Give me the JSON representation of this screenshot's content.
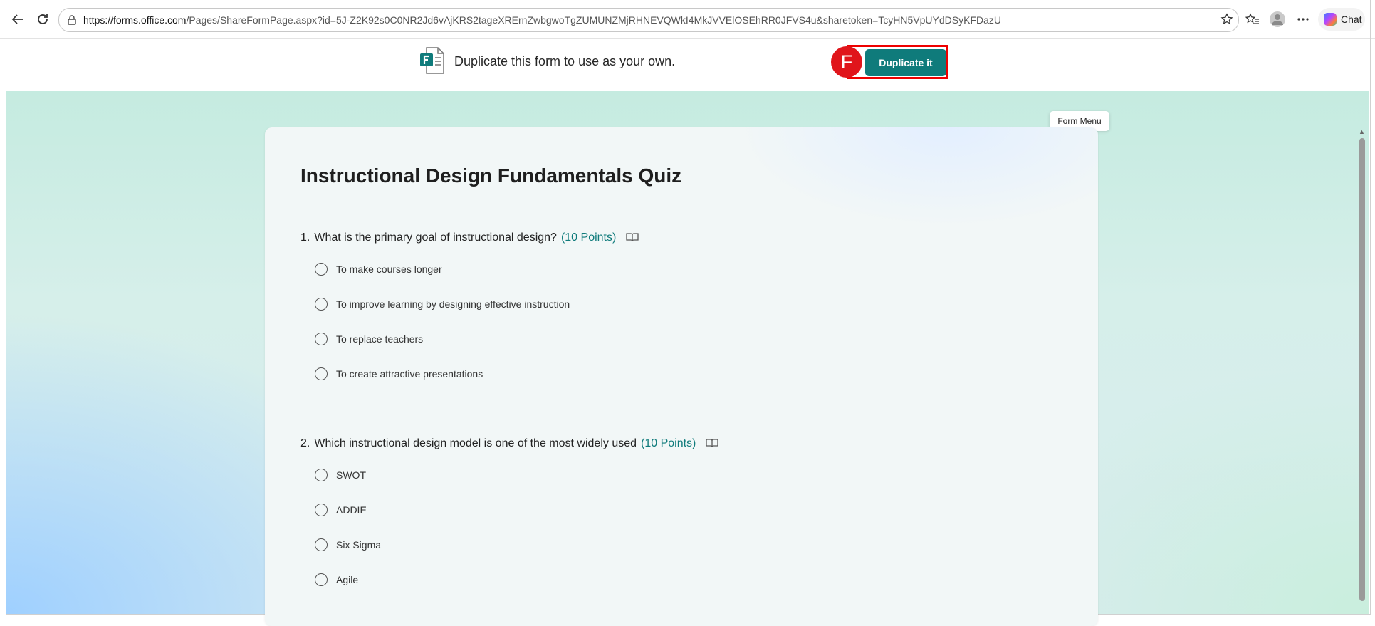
{
  "browser": {
    "url_domain": "https://forms.office.com",
    "url_rest": "/Pages/ShareFormPage.aspx?id=5J-Z2K92s0C0NR2Jd6vAjKRS2tageXRErnZwbgwoTgZUMUNZMjRHNEVQWkI4MkJVVElOSEhRR0JFVS4u&sharetoken=TcyHN5VpUYdDSyKFDazU",
    "chat_label": "Chat"
  },
  "banner": {
    "text": "Duplicate this form to use as your own.",
    "button_label": "Duplicate it",
    "badge_letter": "F"
  },
  "form": {
    "title": "Instructional Design Fundamentals Quiz",
    "tooltip": "Form Menu",
    "questions": [
      {
        "number": "1.",
        "text": "What is the primary goal of instructional design?",
        "points": "(10 Points)",
        "options": [
          "To make courses longer",
          "To improve learning by designing effective instruction",
          "To replace teachers",
          "To create attractive presentations"
        ]
      },
      {
        "number": "2.",
        "text": "Which instructional design model is one of the most widely used",
        "points": "(10 Points)",
        "options": [
          "SWOT",
          "ADDIE",
          "Six Sigma",
          "Agile"
        ]
      }
    ]
  },
  "colors": {
    "accent": "#0f7b7b",
    "badge": "#e0151b",
    "highlight_outline": "#ee0000"
  }
}
